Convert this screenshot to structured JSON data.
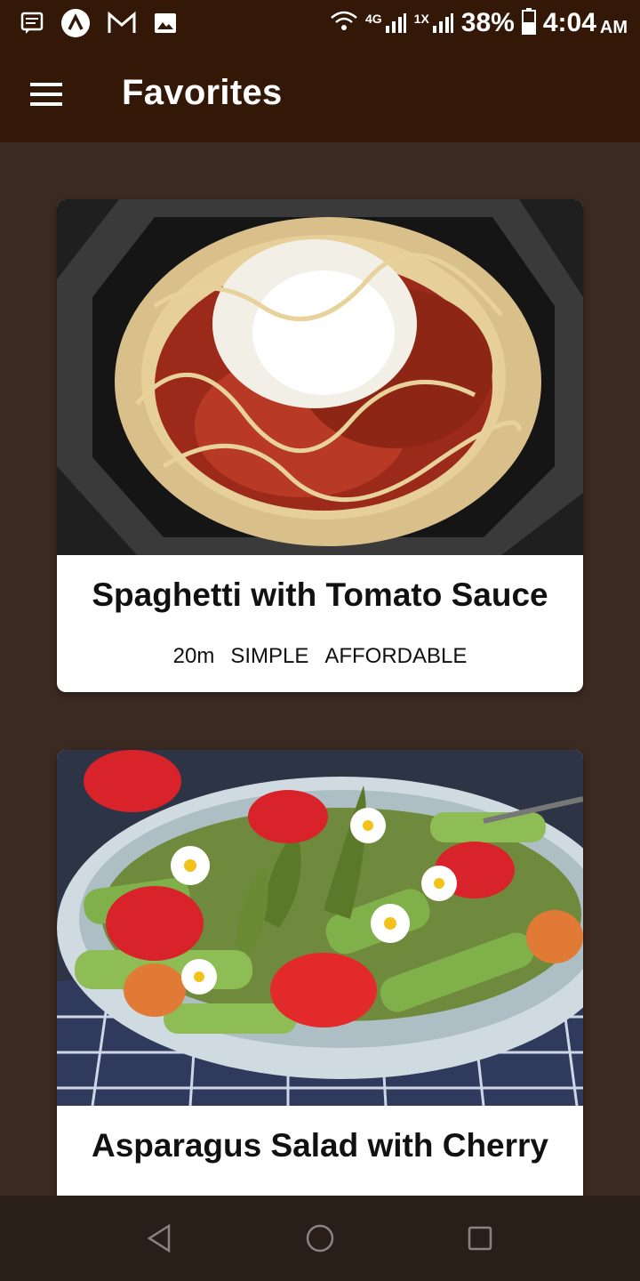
{
  "status_bar": {
    "left_icons": [
      "message-icon",
      "app-a-icon",
      "gmail-icon",
      "image-icon"
    ],
    "network_1": "4G",
    "network_2": "1X",
    "battery": "38%",
    "time": "4:04",
    "ampm": "AM"
  },
  "app_bar": {
    "menu_icon": "menu-icon",
    "title": "Favorites",
    "background": "#331707"
  },
  "meals": [
    {
      "title": "Spaghetti with Tomato Sauce",
      "duration": "20m",
      "complexity": "SIMPLE",
      "affordability": "AFFORDABLE"
    },
    {
      "title": "Asparagus Salad with Cherry"
    }
  ],
  "nav_bar": {
    "back": "back-icon",
    "home": "home-icon",
    "recents": "recents-icon"
  },
  "colors": {
    "body": "#3b2a22",
    "card": "#ffffff"
  }
}
